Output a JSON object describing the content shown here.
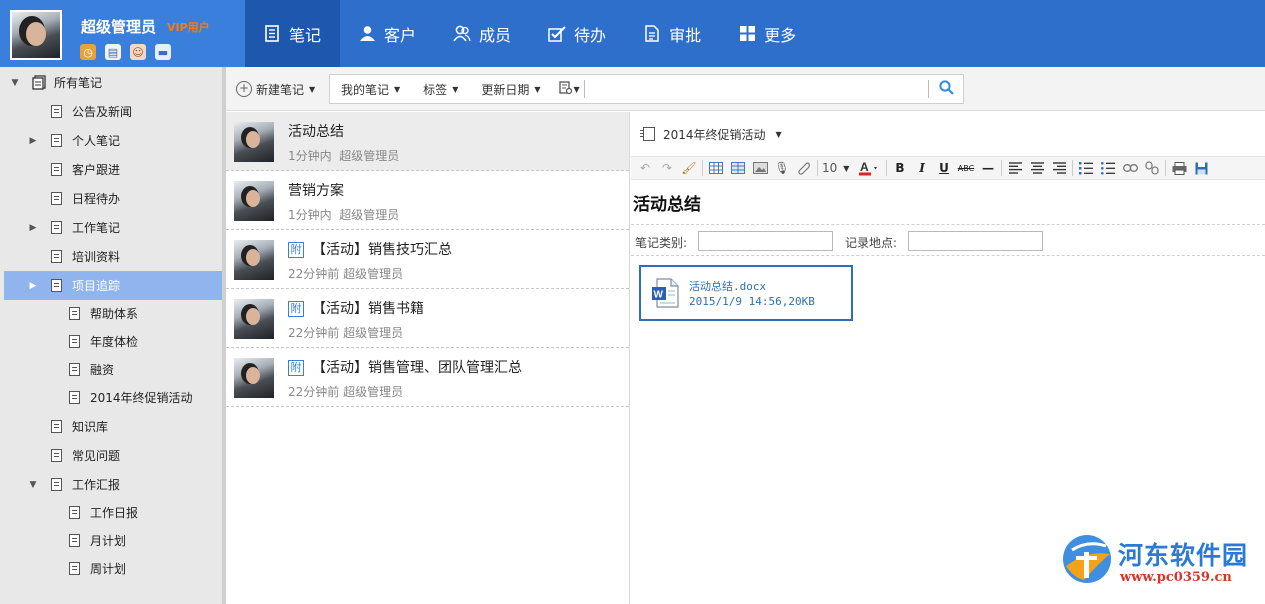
{
  "header": {
    "username": "超级管理员",
    "vip_badge": "VIP用户",
    "profile_icons": [
      "alarm-clock-icon",
      "notebook-icon",
      "contact-icon",
      "chat-icon"
    ],
    "nav_tabs": [
      {
        "label": "笔记",
        "icon": "note-icon",
        "active": true
      },
      {
        "label": "客户",
        "icon": "customer-icon",
        "active": false
      },
      {
        "label": "成员",
        "icon": "members-icon",
        "active": false
      },
      {
        "label": "待办",
        "icon": "todo-check-icon",
        "active": false
      },
      {
        "label": "审批",
        "icon": "approval-doc-icon",
        "active": false
      },
      {
        "label": "更多",
        "icon": "grid-plus-icon",
        "active": false
      }
    ]
  },
  "sidebar": {
    "root_label": "所有笔记",
    "items": [
      {
        "label": "公告及新闻"
      },
      {
        "label": "个人笔记"
      },
      {
        "label": "客户跟进"
      },
      {
        "label": "日程待办"
      },
      {
        "label": "工作笔记"
      },
      {
        "label": "培训资料"
      },
      {
        "label": "项目追踪"
      },
      {
        "label": "帮助体系"
      },
      {
        "label": "年度体检"
      },
      {
        "label": "融资"
      },
      {
        "label": "2014年终促销活动"
      },
      {
        "label": "知识库"
      },
      {
        "label": "常见问题"
      },
      {
        "label": "工作汇报"
      },
      {
        "label": "工作日报"
      },
      {
        "label": "月计划"
      },
      {
        "label": "周计划"
      }
    ]
  },
  "toolbar": {
    "new_note_label": "新建笔记",
    "filter_mine": "我的笔记",
    "filter_tags": "标签",
    "filter_sort": "更新日期",
    "search_placeholder": ""
  },
  "notes": [
    {
      "title": "活动总结",
      "time": "1分钟内",
      "author": "超级管理员",
      "attachment": false
    },
    {
      "title": "营销方案",
      "time": "1分钟内",
      "author": "超级管理员",
      "attachment": false
    },
    {
      "title": "【活动】销售技巧汇总",
      "time": "22分钟前",
      "author": "超级管理员",
      "attachment": true
    },
    {
      "title": "【活动】销售书籍",
      "time": "22分钟前",
      "author": "超级管理员",
      "attachment": true
    },
    {
      "title": "【活动】销售管理、团队管理汇总",
      "time": "22分钟前",
      "author": "超级管理员",
      "attachment": true
    }
  ],
  "attach_badge": "附",
  "editor": {
    "notebook": "2014年终促销活动",
    "font_size": "10",
    "heading": "活动总结",
    "category_label": "笔记类别:",
    "category_value": "",
    "location_label": "记录地点:",
    "location_value": "",
    "attachment_name": "活动总结.docx",
    "attachment_info": "2015/1/9 14:56,20KB"
  },
  "watermark": {
    "title": "河东软件园",
    "url": "www.pc0359.cn"
  },
  "colors": {
    "header_bg": "#2f6fcc",
    "nav_active": "#1d58ae",
    "sidebar_selected": "#8fb4ee",
    "vip_orange": "#ff7a00",
    "attachment_blue": "#2f6fb3"
  }
}
